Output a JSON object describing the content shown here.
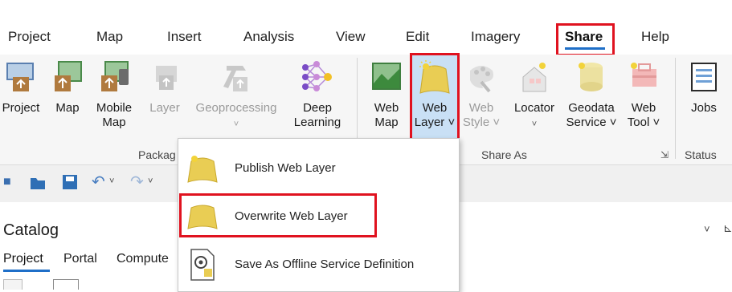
{
  "tabs": [
    {
      "label": "Project"
    },
    {
      "label": "Map"
    },
    {
      "label": "Insert"
    },
    {
      "label": "Analysis"
    },
    {
      "label": "View"
    },
    {
      "label": "Edit"
    },
    {
      "label": "Imagery"
    },
    {
      "label": "Share"
    },
    {
      "label": "Help"
    }
  ],
  "active_tab": "Share",
  "ribbon": {
    "package_buttons": [
      {
        "label1": "Project",
        "label2": ""
      },
      {
        "label1": "Map",
        "label2": ""
      },
      {
        "label1": "Mobile",
        "label2": "Map"
      },
      {
        "label1": "Layer",
        "label2": ""
      },
      {
        "label1": "Geoprocessing",
        "label2": "˅"
      },
      {
        "label1": "Deep",
        "label2": "Learning"
      }
    ],
    "share_as_buttons": [
      {
        "label1": "Web",
        "label2": "Map"
      },
      {
        "label1": "Web",
        "label2": "Layer ˅"
      },
      {
        "label1": "Web",
        "label2": "Style ˅"
      },
      {
        "label1": "Locator",
        "label2": "˅"
      },
      {
        "label1": "Geodata",
        "label2": "Service ˅"
      },
      {
        "label1": "Web",
        "label2": "Tool ˅"
      }
    ],
    "status_buttons": [
      {
        "label1": "Jobs"
      }
    ],
    "groups": {
      "package": "Packag",
      "share_as": "Share As",
      "status": "Status"
    }
  },
  "dropdown": {
    "items": [
      {
        "label": "Publish Web Layer"
      },
      {
        "label": "Overwrite Web Layer"
      },
      {
        "label": "Save As Offline Service Definition"
      }
    ]
  },
  "catalog": {
    "title": "Catalog",
    "tabs": [
      {
        "label": "Project"
      },
      {
        "label": "Portal"
      },
      {
        "label": "Compute"
      }
    ]
  },
  "colors": {
    "highlight": "#e0121f",
    "accent": "#1f6fc8",
    "layer_yellow": "#e9cd54"
  }
}
